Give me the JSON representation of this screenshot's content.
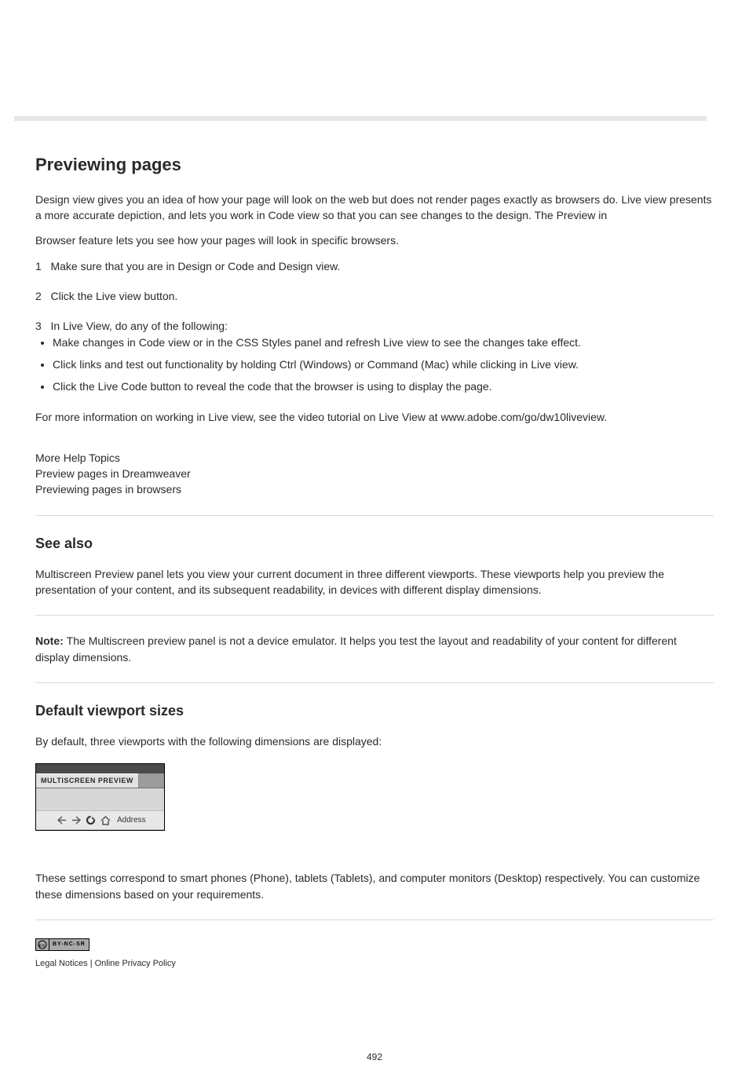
{
  "page": {
    "number": "492"
  },
  "article": {
    "title": "Previewing pages",
    "intro1a": "Design view gives you an idea of how your page will look on the web but does not render pages exactly as browsers do. Live view presents a more accurate depiction, and lets you work in Code view so that you can see changes to the design. The Preview in",
    "intro1b": "Browser feature lets you see how your pages will look in specific browsers."
  },
  "steps": {
    "step1": {
      "num": "1",
      "text": "Make sure that you are in Design or Code and Design view."
    },
    "step2": {
      "num": "2",
      "text": "Click the Live view button."
    },
    "step3": {
      "num": "3",
      "lead": "In Live View, do any of the following:",
      "items": [
        "Make changes in Code view or in the CSS Styles panel and refresh Live view to see the changes take effect.",
        "Click links and test out functionality by holding Ctrl (Windows) or Command (Mac) while clicking in Live view.",
        "Click the Live Code button to reveal the code that the browser is using to display the page."
      ],
      "followup": "For more information on working in Live view, see the video tutorial on Live View at www.adobe.com/go/dw10liveview."
    }
  },
  "links": {
    "label": "More Help Topics",
    "a": "Preview pages in Dreamweaver",
    "b": "Previewing pages in browsers"
  },
  "see_intro": {
    "title": "See also",
    "text": "Multiscreen Preview panel lets you view your current document in three different viewports. These viewports help you preview the presentation of your content, and its subsequent readability, in devices with different display dimensions."
  },
  "note": {
    "label": "Note: ",
    "text": "The Multiscreen preview panel is not a device emulator. It helps you test the layout and readability of your content for different display dimensions."
  },
  "viewport": {
    "title": "Default viewport sizes",
    "p1": "By default, three viewports with the following dimensions are displayed:",
    "p2": "These settings correspond to smart phones (Phone), tablets (Tablets), and computer monitors (Desktop) respectively. You can customize these dimensions based on your requirements."
  },
  "msp": {
    "tab": "MULTISCREEN PREVIEW",
    "addr": "Address"
  },
  "cc": {
    "label": "BY-NC-SR"
  },
  "footer": {
    "text": "Legal Notices   |   Online Privacy Policy"
  }
}
